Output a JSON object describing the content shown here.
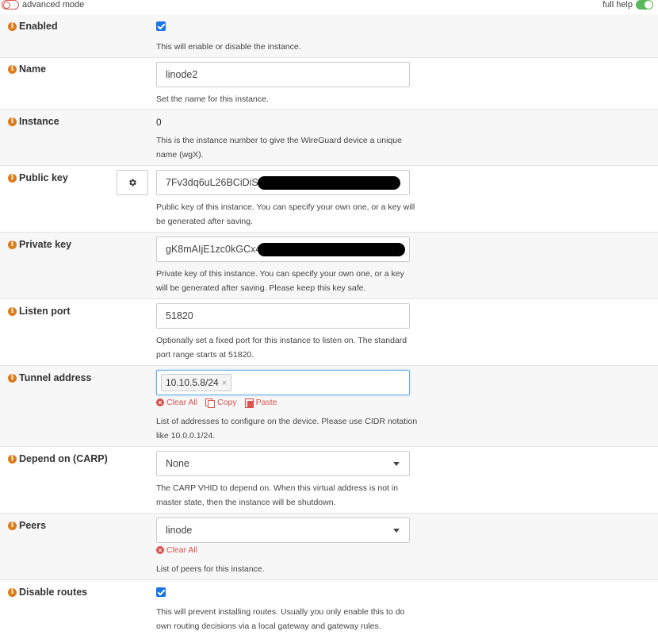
{
  "topbar": {
    "advanced_mode": "advanced mode",
    "full_help": "full help"
  },
  "colors": {
    "info_icon": "#e07b1a",
    "checkbox": "#1a73e8",
    "danger": "#d9534f",
    "toggle_on": "#5cb85c"
  },
  "fields": {
    "enabled": {
      "label": "Enabled",
      "checked": true,
      "help": "This will enable or disable the instance."
    },
    "name": {
      "label": "Name",
      "value": "linode2",
      "help": "Set the name for this instance."
    },
    "instance": {
      "label": "Instance",
      "value": "0",
      "help": "This is the instance number to give the WireGuard device a unique name (wgX)."
    },
    "public_key": {
      "label": "Public key",
      "value": "7Fv3dq6uL26BCiDiSa",
      "icon": "gear-icon",
      "help": "Public key of this instance. You can specify your own one, or a key will be generated after saving."
    },
    "private_key": {
      "label": "Private key",
      "value": "gK8mAIjE1zc0kGCx4G",
      "help": "Private key of this instance. You can specify your own one, or a key will be generated after saving. Please keep this key safe."
    },
    "listen_port": {
      "label": "Listen port",
      "value": "51820",
      "help": "Optionally set a fixed port for this instance to listen on. The standard port range starts at 51820."
    },
    "tunnel_address": {
      "label": "Tunnel address",
      "token": "10.10.5.8/24",
      "clear_all": "Clear All",
      "copy": "Copy",
      "paste": "Paste",
      "help": "List of addresses to configure on the device. Please use CIDR notation like 10.0.0.1/24."
    },
    "depend_on": {
      "label": "Depend on (CARP)",
      "value": "None",
      "help": "The CARP VHID to depend on. When this virtual address is not in master state, then the instance will be shutdown."
    },
    "peers": {
      "label": "Peers",
      "value": "linode",
      "clear_all": "Clear All",
      "help": "List of peers for this instance."
    },
    "disable_routes": {
      "label": "Disable routes",
      "checked": true,
      "help": "This will prevent installing routes. Usually you only enable this to do own routing decisions via a local gateway and gateway rules."
    }
  }
}
